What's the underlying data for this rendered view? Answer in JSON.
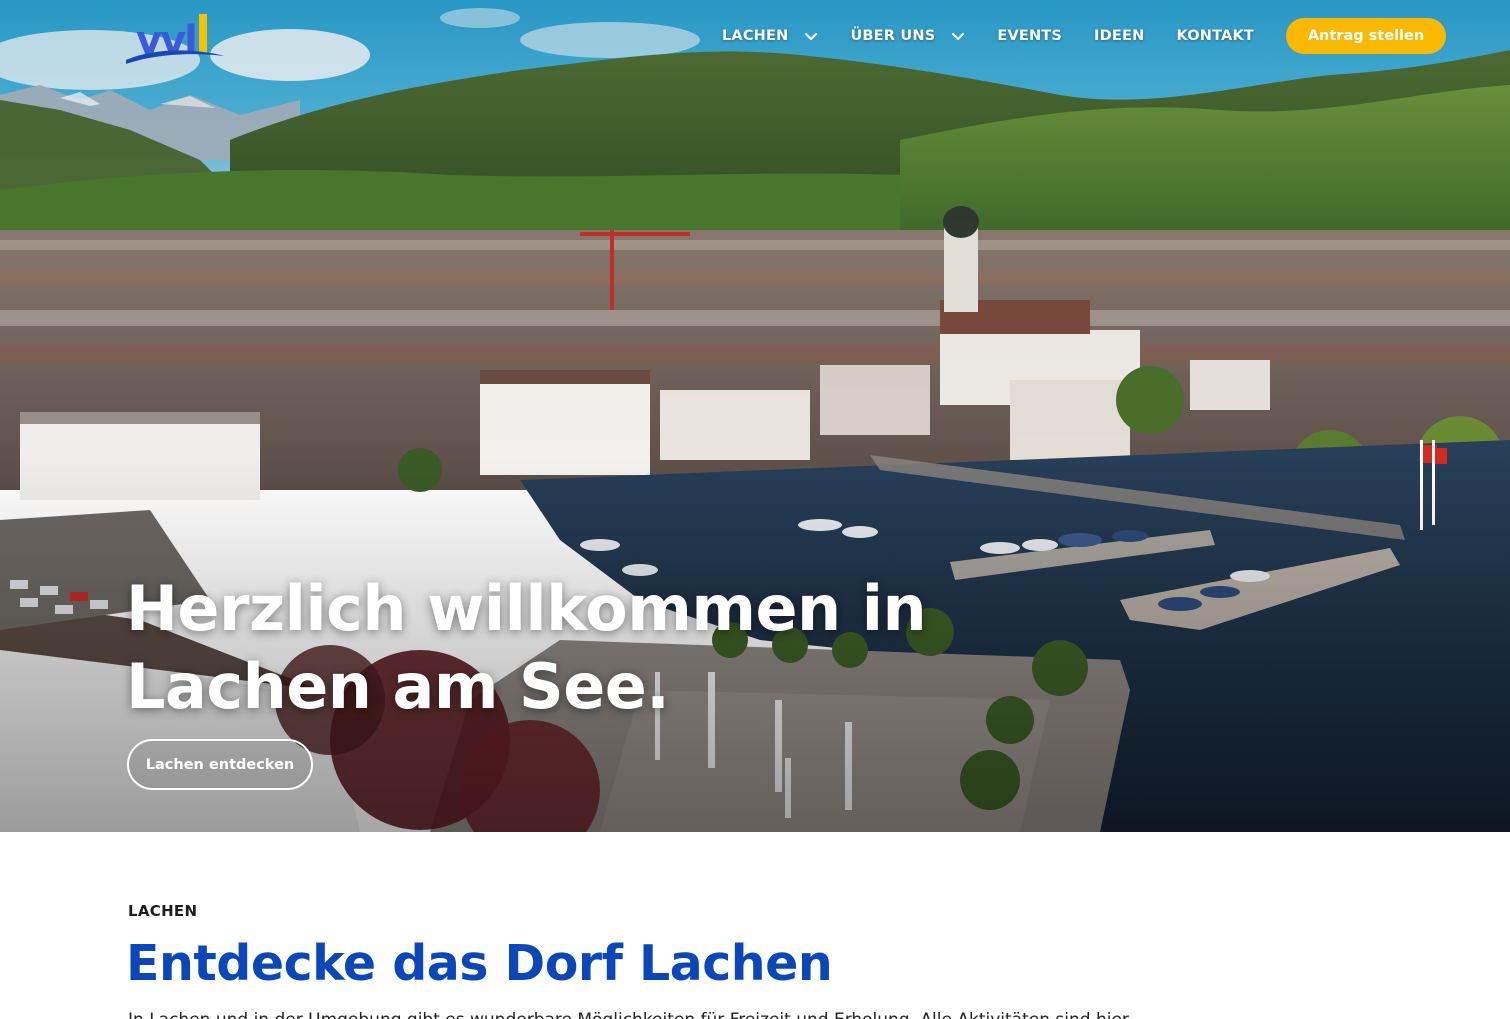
{
  "brand": {
    "logo_text": "vvl",
    "logo_text_color": "#3a5ad9",
    "logo_bar_color": "#f7c300",
    "logo_wave_color": "#1c46b3"
  },
  "nav": {
    "items": [
      {
        "label": "LACHEN",
        "has_dropdown": true
      },
      {
        "label": "ÜBER UNS",
        "has_dropdown": true
      },
      {
        "label": "EVENTS",
        "has_dropdown": false
      },
      {
        "label": "IDEEN",
        "has_dropdown": false
      },
      {
        "label": "KONTAKT",
        "has_dropdown": false
      }
    ],
    "cta_label": "Antrag stellen",
    "cta_color": "#fbb800"
  },
  "hero": {
    "title_line1": "Herzlich willkommen in",
    "title_line2": "Lachen am See.",
    "button_label": "Lachen entdecken"
  },
  "section": {
    "label": "LACHEN",
    "title": "Entdecke das Dorf Lachen",
    "text": "In Lachen und in der Umgebung gibt es wunderbare Möglichkeiten für Freizeit und Erholung. Alle Aktivitäten sind hier."
  },
  "colors": {
    "heading_blue": "#0b47b8",
    "text_dark": "#1d1d1d"
  }
}
